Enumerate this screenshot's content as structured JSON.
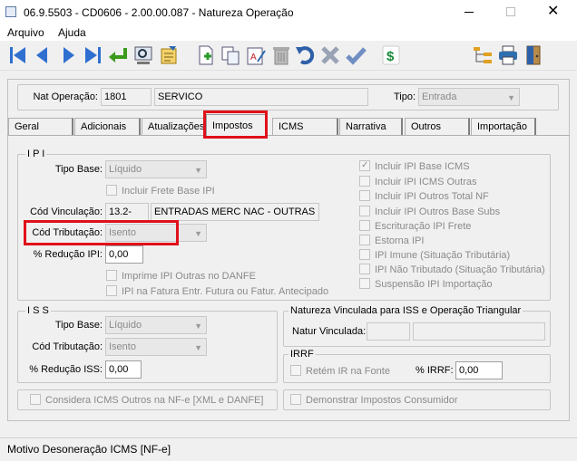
{
  "window": {
    "title": "06.9.5503 - CD0606 - 2.00.00.087 - Natureza Operação"
  },
  "menu": [
    "Arquivo",
    "Ajuda"
  ],
  "header": {
    "nat_label": "Nat Operação:",
    "nat_code": "1801",
    "nat_desc": "SERVICO",
    "tipo_label": "Tipo:",
    "tipo_value": "Entrada"
  },
  "tabs": [
    "Geral",
    "Adicionais",
    "Atualizações",
    "Impostos",
    "ICMS",
    "Narrativa",
    "Outros",
    "Importação"
  ],
  "ipi": {
    "title": "I P I",
    "tipo_base_label": "Tipo Base:",
    "tipo_base": "Líquido",
    "frete_label": "Incluir Frete Base IPI",
    "cod_vinc_label": "Cód Vinculação:",
    "cod_vinc": "13.2-",
    "cod_vinc_desc": "ENTRADAS MERC NAC - OUTRAS",
    "cod_trib_label": "Cód Tributação:",
    "cod_trib": "Isento",
    "reducao_label": "% Redução IPI:",
    "reducao": "0,00",
    "imprime_label": "Imprime IPI Outras no DANFE",
    "fatura_label": "IPI na Fatura Entr. Futura ou Fatur. Antecipado",
    "checks": [
      {
        "label": "Incluir IPI Base ICMS",
        "checked": true
      },
      {
        "label": "Incluir IPI ICMS Outras",
        "checked": false
      },
      {
        "label": "Incluir IPI Outros Total NF",
        "checked": false
      },
      {
        "label": "Incluir IPI Outros Base Subs",
        "checked": false
      },
      {
        "label": "Escrituração IPI Frete",
        "checked": false
      },
      {
        "label": "Estorna IPI",
        "checked": false
      },
      {
        "label": "IPI Imune (Situação Tributária)",
        "checked": false
      },
      {
        "label": "IPI Não Tributado (Situação Tributária)",
        "checked": false
      },
      {
        "label": "Suspensão IPI Importação",
        "checked": false
      }
    ]
  },
  "iss": {
    "title": "I S S",
    "tipo_base_label": "Tipo Base:",
    "tipo_base": "Líquido",
    "cod_trib_label": "Cód Tributação:",
    "cod_trib": "Isento",
    "reducao_label": "% Redução ISS:",
    "reducao": "0,00"
  },
  "natureza": {
    "title": "Natureza Vinculada para ISS e Operação Triangular",
    "label": "Natur Vinculada:"
  },
  "irrf": {
    "title": "IRRF",
    "retem_label": "Retém IR na Fonte",
    "perc_label": "% IRRF:",
    "perc": "0,00"
  },
  "bottom": {
    "considera": "Considera ICMS Outros na NF-e [XML e DANFE]",
    "demonstrar": "Demonstrar Impostos Consumidor"
  },
  "status": {
    "text": "Motivo Desoneração ICMS [NF-e]"
  }
}
